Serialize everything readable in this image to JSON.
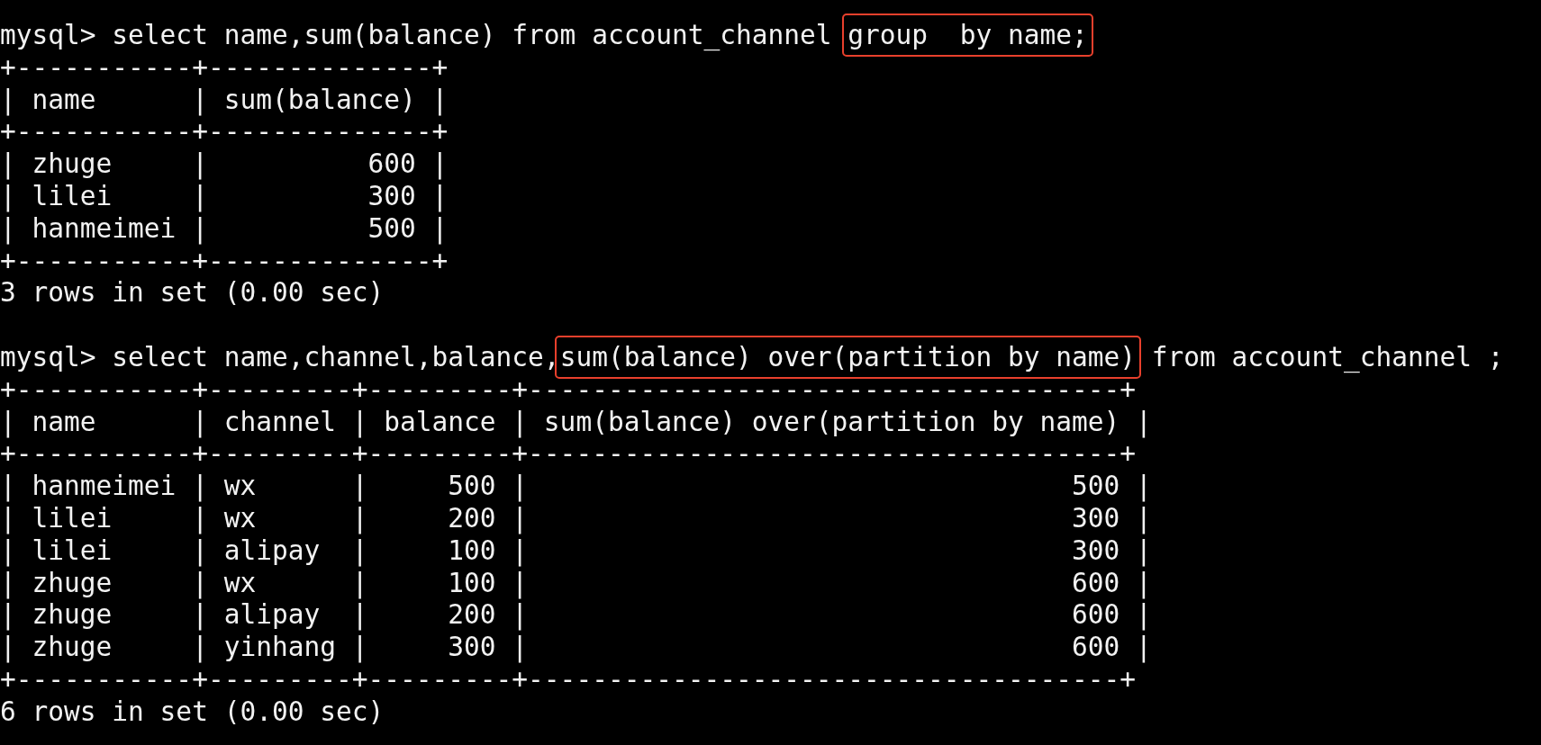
{
  "terminal": {
    "lines": [
      {
        "kind": "text",
        "segments": [
          {
            "text": "mysql> select name,sum(balance) from account_channel ",
            "highlighted": false
          },
          {
            "text": "group  by name;",
            "highlighted": true
          }
        ]
      },
      {
        "kind": "text",
        "segments": [
          {
            "text": "+-----------+--------------+",
            "highlighted": false
          }
        ]
      },
      {
        "kind": "text",
        "segments": [
          {
            "text": "| name      | sum(balance) |",
            "highlighted": false
          }
        ]
      },
      {
        "kind": "text",
        "segments": [
          {
            "text": "+-----------+--------------+",
            "highlighted": false
          }
        ]
      },
      {
        "kind": "text",
        "segments": [
          {
            "text": "| zhuge     |          600 |",
            "highlighted": false
          }
        ]
      },
      {
        "kind": "text",
        "segments": [
          {
            "text": "| lilei     |          300 |",
            "highlighted": false
          }
        ]
      },
      {
        "kind": "text",
        "segments": [
          {
            "text": "| hanmeimei |          500 |",
            "highlighted": false
          }
        ]
      },
      {
        "kind": "text",
        "segments": [
          {
            "text": "+-----------+--------------+",
            "highlighted": false
          }
        ]
      },
      {
        "kind": "text",
        "segments": [
          {
            "text": "3 rows in set (0.00 sec)",
            "highlighted": false
          }
        ]
      },
      {
        "kind": "blank"
      },
      {
        "kind": "text",
        "segments": [
          {
            "text": "mysql> select name,channel,balance,",
            "highlighted": false
          },
          {
            "text": "sum(balance) over(partition by name)",
            "highlighted": true
          },
          {
            "text": " from account_channel ;",
            "highlighted": false
          }
        ]
      },
      {
        "kind": "text",
        "segments": [
          {
            "text": "+-----------+---------+---------+-------------------------------------+",
            "highlighted": false
          }
        ]
      },
      {
        "kind": "text",
        "segments": [
          {
            "text": "| name      | channel | balance | sum(balance) over(partition by name) |",
            "highlighted": false
          }
        ]
      },
      {
        "kind": "text",
        "segments": [
          {
            "text": "+-----------+---------+---------+-------------------------------------+",
            "highlighted": false
          }
        ]
      },
      {
        "kind": "text",
        "segments": [
          {
            "text": "| hanmeimei | wx      |     500 |                                  500 |",
            "highlighted": false
          }
        ]
      },
      {
        "kind": "text",
        "segments": [
          {
            "text": "| lilei     | wx      |     200 |                                  300 |",
            "highlighted": false
          }
        ]
      },
      {
        "kind": "text",
        "segments": [
          {
            "text": "| lilei     | alipay  |     100 |                                  300 |",
            "highlighted": false
          }
        ]
      },
      {
        "kind": "text",
        "segments": [
          {
            "text": "| zhuge     | wx      |     100 |                                  600 |",
            "highlighted": false
          }
        ]
      },
      {
        "kind": "text",
        "segments": [
          {
            "text": "| zhuge     | alipay  |     200 |                                  600 |",
            "highlighted": false
          }
        ]
      },
      {
        "kind": "text",
        "segments": [
          {
            "text": "| zhuge     | yinhang |     300 |                                  600 |",
            "highlighted": false
          }
        ]
      },
      {
        "kind": "text",
        "segments": [
          {
            "text": "+-----------+---------+---------+-------------------------------------+",
            "highlighted": false
          }
        ]
      },
      {
        "kind": "text",
        "segments": [
          {
            "text": "6 rows in set (0.00 sec)",
            "highlighted": false
          }
        ]
      }
    ]
  }
}
